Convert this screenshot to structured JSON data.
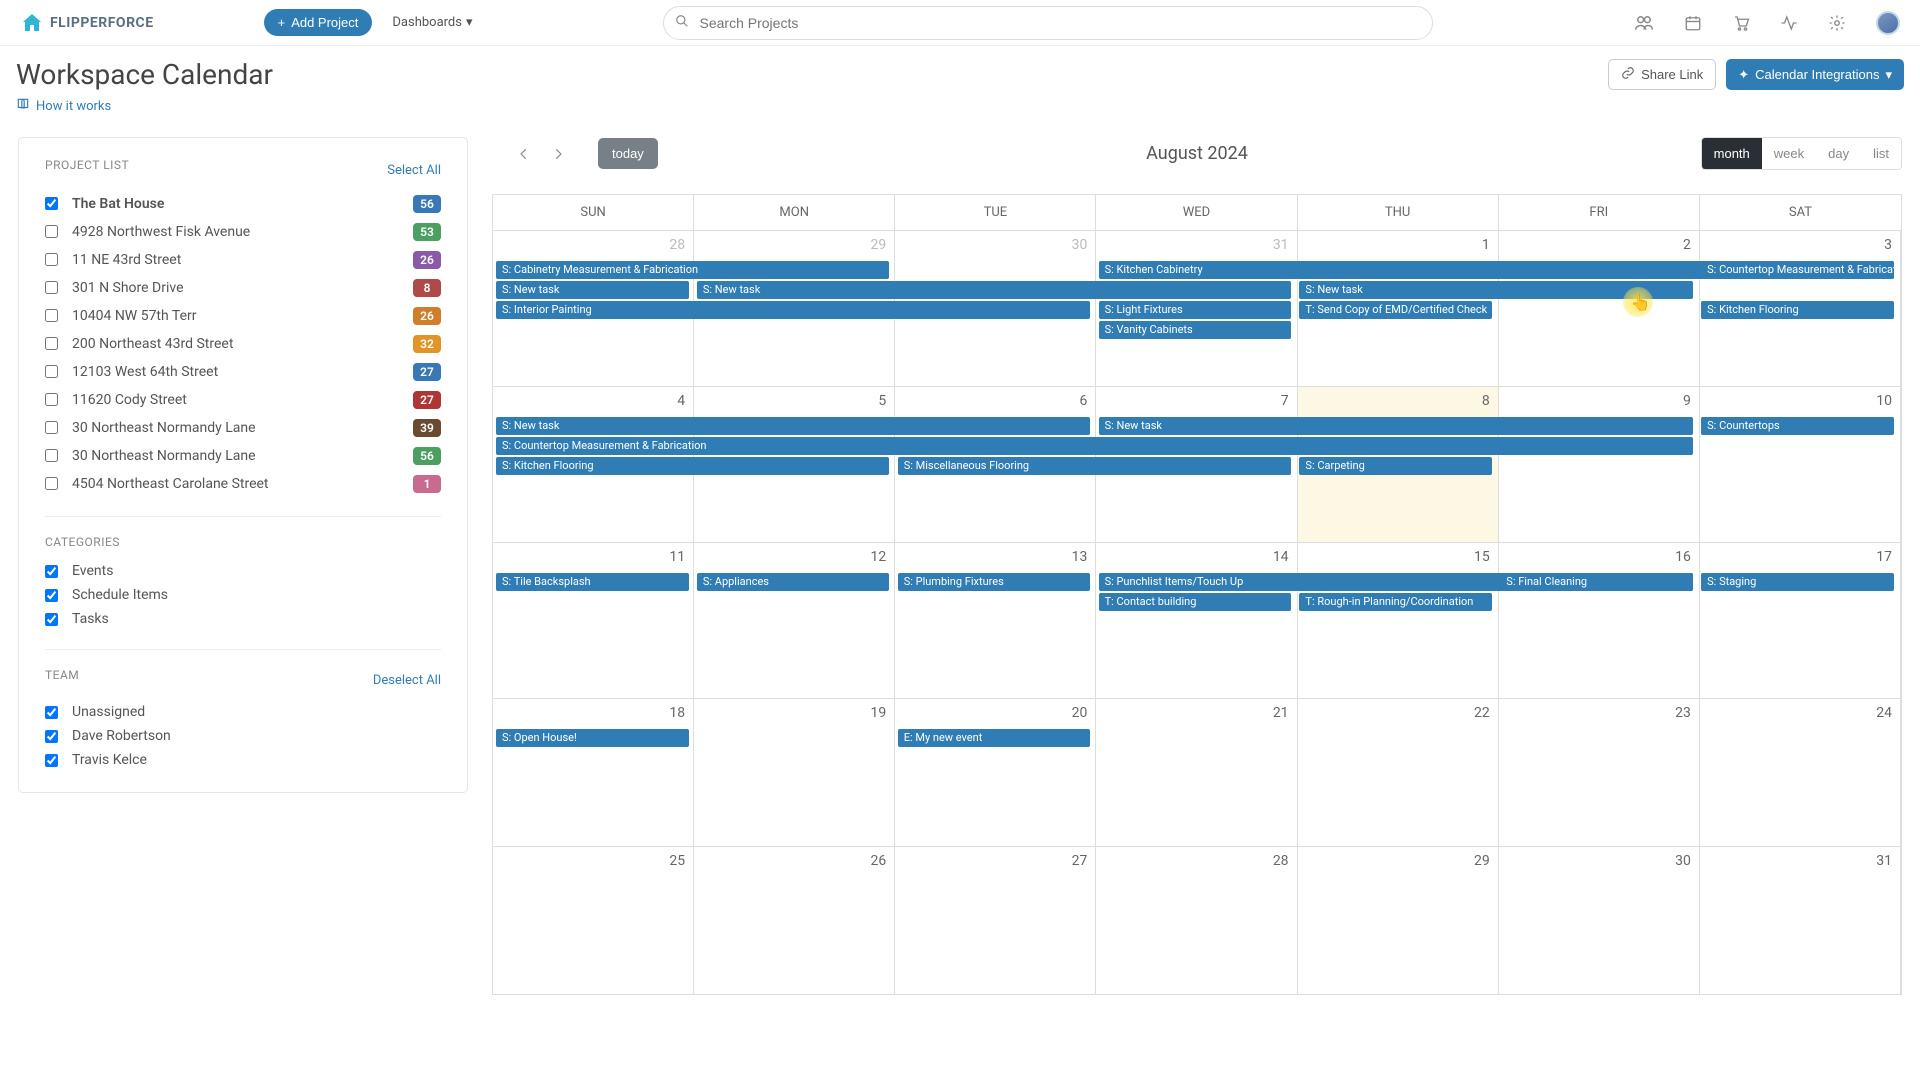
{
  "brand": {
    "name": "FLIPPERFORCE"
  },
  "topbar": {
    "add_project": "Add Project",
    "dashboards": "Dashboards",
    "search_placeholder": "Search Projects"
  },
  "page": {
    "title": "Workspace Calendar",
    "how_link": "How it works",
    "share_link": "Share Link",
    "calendar_integrations": "Calendar Integrations"
  },
  "sidebar": {
    "project_list_title": "PROJECT LIST",
    "select_all": "Select All",
    "projects": [
      {
        "label": "The Bat House",
        "count": "56",
        "color": "#3a78b5",
        "checked": true
      },
      {
        "label": "4928 Northwest Fisk Avenue",
        "count": "53",
        "color": "#4d9e63",
        "checked": false
      },
      {
        "label": "11 NE 43rd Street",
        "count": "26",
        "color": "#8a5aa8",
        "checked": false
      },
      {
        "label": "301 N Shore Drive",
        "count": "8",
        "color": "#b04a4a",
        "checked": false
      },
      {
        "label": "10404 NW 57th Terr",
        "count": "26",
        "color": "#cf7f2b",
        "checked": false
      },
      {
        "label": "200 Northeast 43rd Street",
        "count": "32",
        "color": "#e29429",
        "checked": false
      },
      {
        "label": "12103 West 64th Street",
        "count": "27",
        "color": "#3a78b5",
        "checked": false
      },
      {
        "label": "11620 Cody Street",
        "count": "27",
        "color": "#b03535",
        "checked": false
      },
      {
        "label": "30 Northeast Normandy Lane",
        "count": "39",
        "color": "#6b4a32",
        "checked": false
      },
      {
        "label": "30 Northeast Normandy Lane",
        "count": "56",
        "color": "#4d9e63",
        "checked": false
      },
      {
        "label": "4504 Northeast Carolane Street",
        "count": "1",
        "color": "#c96a90",
        "checked": false
      }
    ],
    "categories_title": "CATEGORIES",
    "categories": [
      {
        "label": "Events"
      },
      {
        "label": "Schedule Items"
      },
      {
        "label": "Tasks"
      }
    ],
    "team_title": "TEAM",
    "deselect_all": "Deselect All",
    "team": [
      {
        "label": "Unassigned"
      },
      {
        "label": "Dave Robertson"
      },
      {
        "label": "Travis Kelce"
      }
    ]
  },
  "calendar": {
    "today": "today",
    "month_label": "August 2024",
    "views": {
      "month": "month",
      "week": "week",
      "day": "day",
      "list": "list"
    },
    "dow": [
      "SUN",
      "MON",
      "TUE",
      "WED",
      "THU",
      "FRI",
      "SAT"
    ],
    "rows": [
      {
        "days": [
          "28",
          "29",
          "30",
          "31",
          "1",
          "2",
          "3"
        ],
        "muted_until": 4
      },
      {
        "days": [
          "4",
          "5",
          "6",
          "7",
          "8",
          "9",
          "10"
        ]
      },
      {
        "days": [
          "11",
          "12",
          "13",
          "14",
          "15",
          "16",
          "17"
        ]
      },
      {
        "days": [
          "18",
          "19",
          "20",
          "21",
          "22",
          "23",
          "24"
        ]
      },
      {
        "days": [
          "25",
          "26",
          "27",
          "28",
          "29",
          "30",
          "31"
        ]
      }
    ],
    "events": {
      "r0": [
        {
          "text": "S:  Cabinetry Measurement & Fabrication",
          "col": 0,
          "span": 2,
          "row": 0
        },
        {
          "text": "S:  Kitchen Cabinetry",
          "col": 3,
          "span": 4,
          "row": 0
        },
        {
          "text": "S:  Countertop Measurement & Fabrication",
          "col": 6,
          "span": 1,
          "row": 0
        },
        {
          "text": "S:  New task",
          "col": 0,
          "span": 1,
          "row": 1
        },
        {
          "text": "S:  New task",
          "col": 1,
          "span": 3,
          "row": 1
        },
        {
          "text": "S:  New task",
          "col": 4,
          "span": 2,
          "row": 1
        },
        {
          "text": "S:  Interior Painting",
          "col": 0,
          "span": 3,
          "row": 2
        },
        {
          "text": "S:  Light Fixtures",
          "col": 3,
          "span": 1,
          "row": 2
        },
        {
          "text": "T:  Send Copy of EMD/Certified Check",
          "col": 4,
          "span": 1,
          "row": 2
        },
        {
          "text": "S:  Kitchen Flooring",
          "col": 6,
          "span": 1,
          "row": 2
        },
        {
          "text": "S:  Vanity Cabinets",
          "col": 3,
          "span": 1,
          "row": 3
        }
      ],
      "r1": [
        {
          "text": "S:  New task",
          "col": 0,
          "span": 3,
          "row": 0
        },
        {
          "text": "S:  New task",
          "col": 3,
          "span": 3,
          "row": 0
        },
        {
          "text": "S:  Countertops",
          "col": 6,
          "span": 1,
          "row": 0
        },
        {
          "text": "S:  Countertop Measurement & Fabrication",
          "col": 0,
          "span": 6,
          "row": 1
        },
        {
          "text": "S:  Kitchen Flooring",
          "col": 0,
          "span": 2,
          "row": 2
        },
        {
          "text": "S:  Miscellaneous Flooring",
          "col": 2,
          "span": 2,
          "row": 2
        },
        {
          "text": "S:  Carpeting",
          "col": 4,
          "span": 1,
          "row": 2
        }
      ],
      "r2": [
        {
          "text": "S:  Tile Backsplash",
          "col": 0,
          "span": 1,
          "row": 0
        },
        {
          "text": "S:  Appliances",
          "col": 1,
          "span": 1,
          "row": 0
        },
        {
          "text": "S:  Plumbing Fixtures",
          "col": 2,
          "span": 1,
          "row": 0
        },
        {
          "text": "S:  Punchlist Items/Touch Up",
          "col": 3,
          "span": 3,
          "row": 0
        },
        {
          "text": "S:  Final Cleaning",
          "col": 5,
          "span": 1,
          "row": 0,
          "offset": true
        },
        {
          "text": "S:  Staging",
          "col": 6,
          "span": 1,
          "row": 0
        },
        {
          "text": "T:  Contact building",
          "col": 3,
          "span": 1,
          "row": 1
        },
        {
          "text": "T:  Rough-in Planning/Coordination",
          "col": 4,
          "span": 1,
          "row": 1
        }
      ],
      "r3": [
        {
          "text": "S:  Open House!",
          "col": 0,
          "span": 1,
          "row": 0
        },
        {
          "text": "E:  My new event",
          "col": 2,
          "span": 1,
          "row": 0
        }
      ],
      "r4": []
    }
  }
}
